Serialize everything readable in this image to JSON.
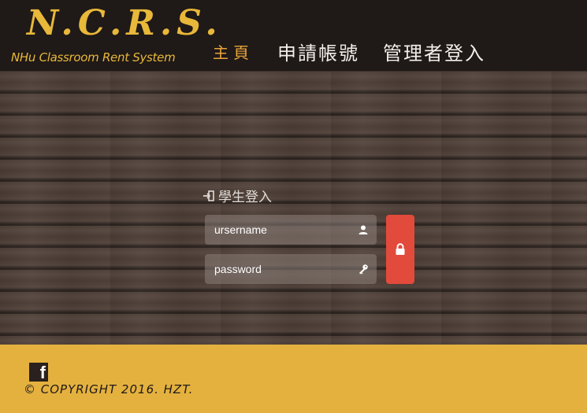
{
  "header": {
    "logo_title": "N.C.R.S.",
    "logo_subtitle": "NHu Classroom Rent System",
    "nav": {
      "home": "主頁",
      "apply": "申請帳號",
      "admin_login": "管理者登入"
    }
  },
  "login": {
    "title": "學生登入",
    "username_placeholder": "ursername",
    "password_placeholder": "password"
  },
  "footer": {
    "facebook_icon_glyph": "f",
    "copyright": "© COPYRIGHT 2016. HZT."
  },
  "colors": {
    "accent_yellow": "#e8b83a",
    "nav_active": "#e8a43a",
    "login_button": "#e24a3c",
    "footer_bg": "#e4b13f",
    "header_bg": "#1f1917"
  },
  "icons": {
    "login": "sign-in-icon",
    "user": "user-icon",
    "key": "key-icon",
    "lock": "lock-icon",
    "facebook": "facebook-icon"
  }
}
